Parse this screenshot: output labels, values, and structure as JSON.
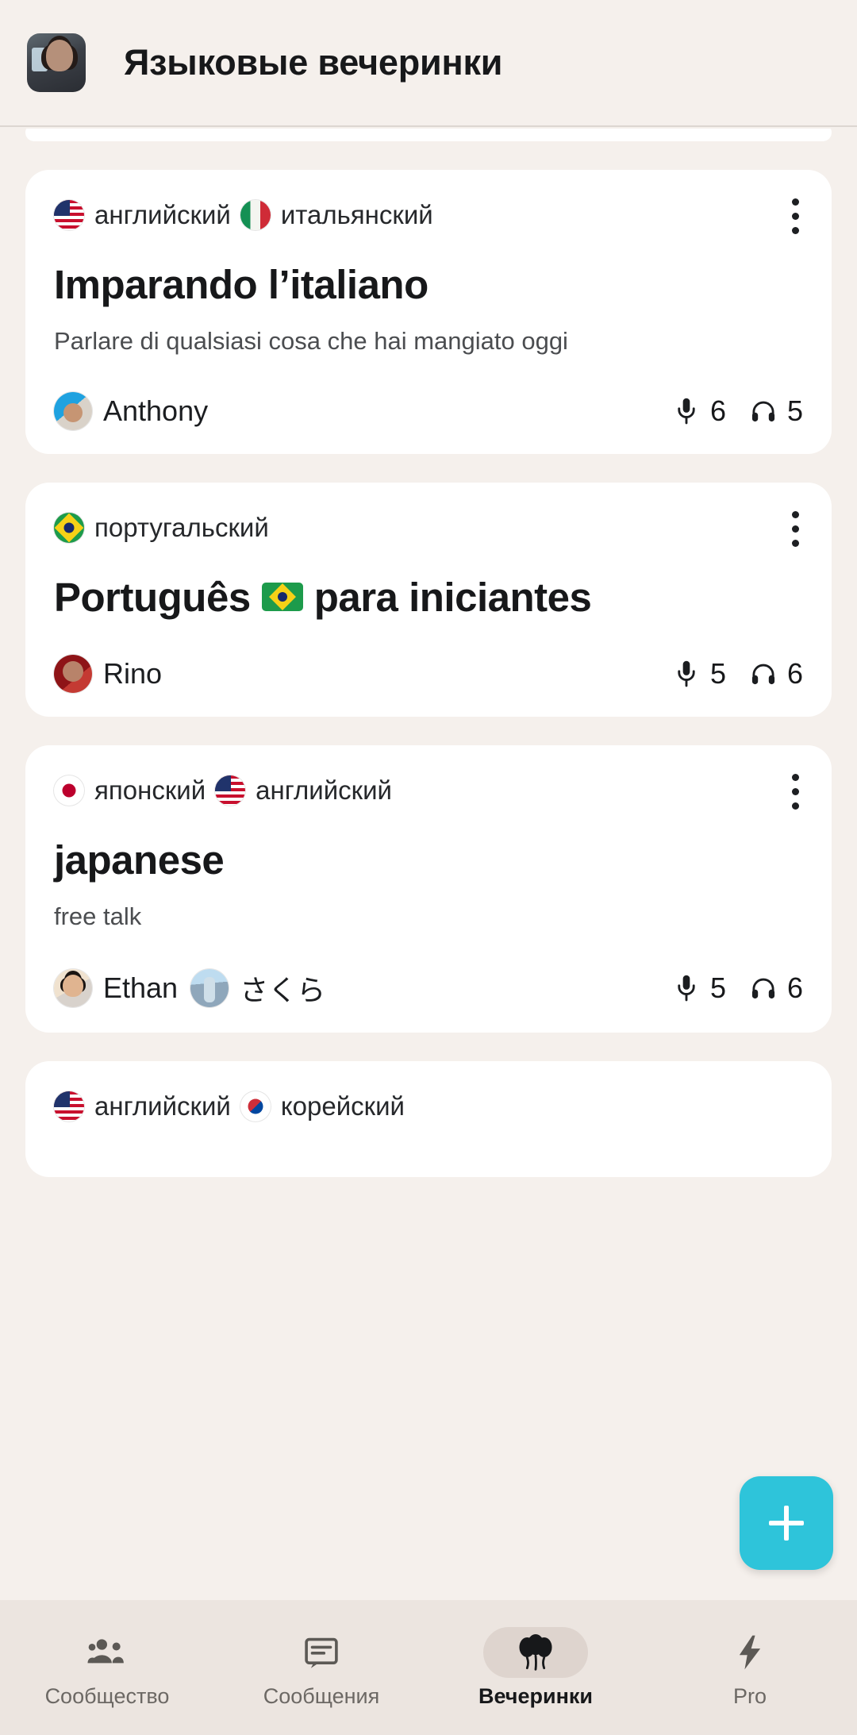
{
  "header": {
    "avatar_name": "user-avatar",
    "title": "Языковые вечеринки"
  },
  "cards": [
    {
      "id": "imparando-litaliano",
      "languages": [
        {
          "flag": "flag-us",
          "icon_name": "flag-us-icon",
          "label": "английский"
        },
        {
          "flag": "flag-it",
          "icon_name": "flag-it-icon",
          "label": "итальянский"
        }
      ],
      "title": "Imparando l’italiano",
      "title_flag": null,
      "title_tail": "",
      "subtitle": "Parlare di qualsiasi cosa che hai mangiato oggi",
      "hosts": [
        {
          "pic": "pic-anthony",
          "name": "Anthony"
        }
      ],
      "speakers": "6",
      "listeners": "5",
      "menu": "more-options"
    },
    {
      "id": "portugues-para-iniciantes",
      "languages": [
        {
          "flag": "flag-br",
          "icon_name": "flag-br-icon",
          "label": "португальский"
        }
      ],
      "title": "Português",
      "title_flag": "flag-br",
      "title_tail": "para iniciantes",
      "subtitle": "",
      "hosts": [
        {
          "pic": "pic-rino",
          "name": "Rino"
        }
      ],
      "speakers": "5",
      "listeners": "6",
      "menu": "more-options"
    },
    {
      "id": "japanese",
      "languages": [
        {
          "flag": "flag-jp",
          "icon_name": "flag-jp-icon",
          "label": "японский"
        },
        {
          "flag": "flag-us",
          "icon_name": "flag-us-icon",
          "label": "английский"
        }
      ],
      "title": "japanese",
      "title_flag": null,
      "title_tail": "",
      "subtitle": "free talk",
      "hosts": [
        {
          "pic": "pic-ethan",
          "name": "Ethan"
        },
        {
          "pic": "pic-sakura",
          "name": "さくら"
        }
      ],
      "speakers": "5",
      "listeners": "6",
      "menu": "more-options"
    },
    {
      "id": "english-korean",
      "languages": [
        {
          "flag": "flag-us",
          "icon_name": "flag-us-icon",
          "label": "английский"
        },
        {
          "flag": "flag-kr",
          "icon_name": "flag-kr-icon",
          "label": "корейский"
        }
      ],
      "title": "",
      "title_flag": null,
      "title_tail": "",
      "subtitle": "",
      "hosts": [],
      "speakers": "",
      "listeners": "",
      "menu": "more-options"
    }
  ],
  "fab": {
    "icon_name": "plus-icon",
    "label": "+",
    "color": "#2ec4da"
  },
  "bottom_nav": {
    "items": [
      {
        "icon_name": "community-icon",
        "label": "Сообщество",
        "active": false
      },
      {
        "icon_name": "messages-icon",
        "label": "Сообщения",
        "active": false
      },
      {
        "icon_name": "parties-balloons-icon",
        "label": "Вечеринки",
        "active": true
      },
      {
        "icon_name": "pro-lightning-icon",
        "label": "Pro",
        "active": false
      }
    ]
  },
  "icons": {
    "mic": "microphone-icon",
    "headphones": "headphones-icon"
  },
  "colors": {
    "page_bg": "#f5f0ec",
    "card_bg": "#ffffff",
    "accent": "#2ec4da",
    "nav_bg": "#ece5e0",
    "text": "#17181a"
  }
}
